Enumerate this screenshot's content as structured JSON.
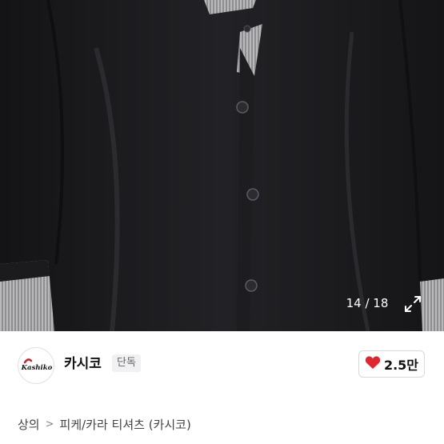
{
  "gallery": {
    "counter": "14 / 18",
    "expand_icon": "expand-arrows-icon"
  },
  "brand": {
    "logo_text": "Kashiko",
    "name": "카시코",
    "badge": "단독"
  },
  "like": {
    "icon": "heart-icon",
    "color": "#e0262e",
    "count": "2.5만"
  },
  "breadcrumb": {
    "level1": "상의",
    "separator": ">",
    "level2": "피케/카라 티셔츠 (카시코)"
  }
}
